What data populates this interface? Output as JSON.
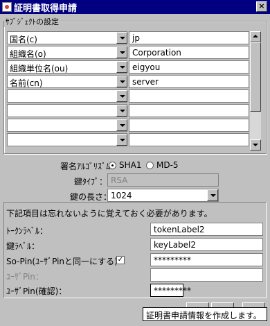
{
  "window": {
    "title": "証明書取得申請",
    "close_glyph": "×"
  },
  "subject": {
    "group_title": "ｻﾌﾞｼﾞｪｸﾄの設定",
    "rows": [
      {
        "attribute": "国名(c)",
        "value": "jp"
      },
      {
        "attribute": "組織名(o)",
        "value": "Corporation"
      },
      {
        "attribute": "組織単位名(ou)",
        "value": "eigyou"
      },
      {
        "attribute": "名前(cn)",
        "value": "server"
      },
      {
        "attribute": "",
        "value": ""
      },
      {
        "attribute": "",
        "value": ""
      },
      {
        "attribute": "",
        "value": ""
      },
      {
        "attribute": "",
        "value": ""
      }
    ]
  },
  "signature": {
    "label": "署名ｱﾙｺﾞﾘｽﾞﾑ：",
    "options": [
      "SHA1",
      "MD-5"
    ],
    "selected": "SHA1"
  },
  "key_type": {
    "label": "鍵ﾀｲﾌﾟ：",
    "value": "RSA"
  },
  "key_length": {
    "label": "鍵の長さ：",
    "value": "1024"
  },
  "notice": "下記項目は忘れないように覚えておく必要があります。",
  "fields": {
    "token_label": {
      "label": "ﾄｰｸﾝﾗﾍﾞﾙ：",
      "value": "tokenLabel2"
    },
    "key_label": {
      "label": "鍵ﾗﾍﾞﾙ：",
      "value": "keyLabel2"
    },
    "so_pin": {
      "label": "So-Pin(ﾕｰｻﾞPinと同一にする)",
      "value": "*********",
      "checked": true,
      "check_glyph": "✓"
    },
    "user_pin": {
      "label": "ﾕｰｻﾞPin：",
      "value": ""
    },
    "user_pin_confirm": {
      "label": "ﾕｰｻﾞPin(確認)：",
      "value": "*********"
    }
  },
  "tooltip": "証明書申請情報を作成します。"
}
